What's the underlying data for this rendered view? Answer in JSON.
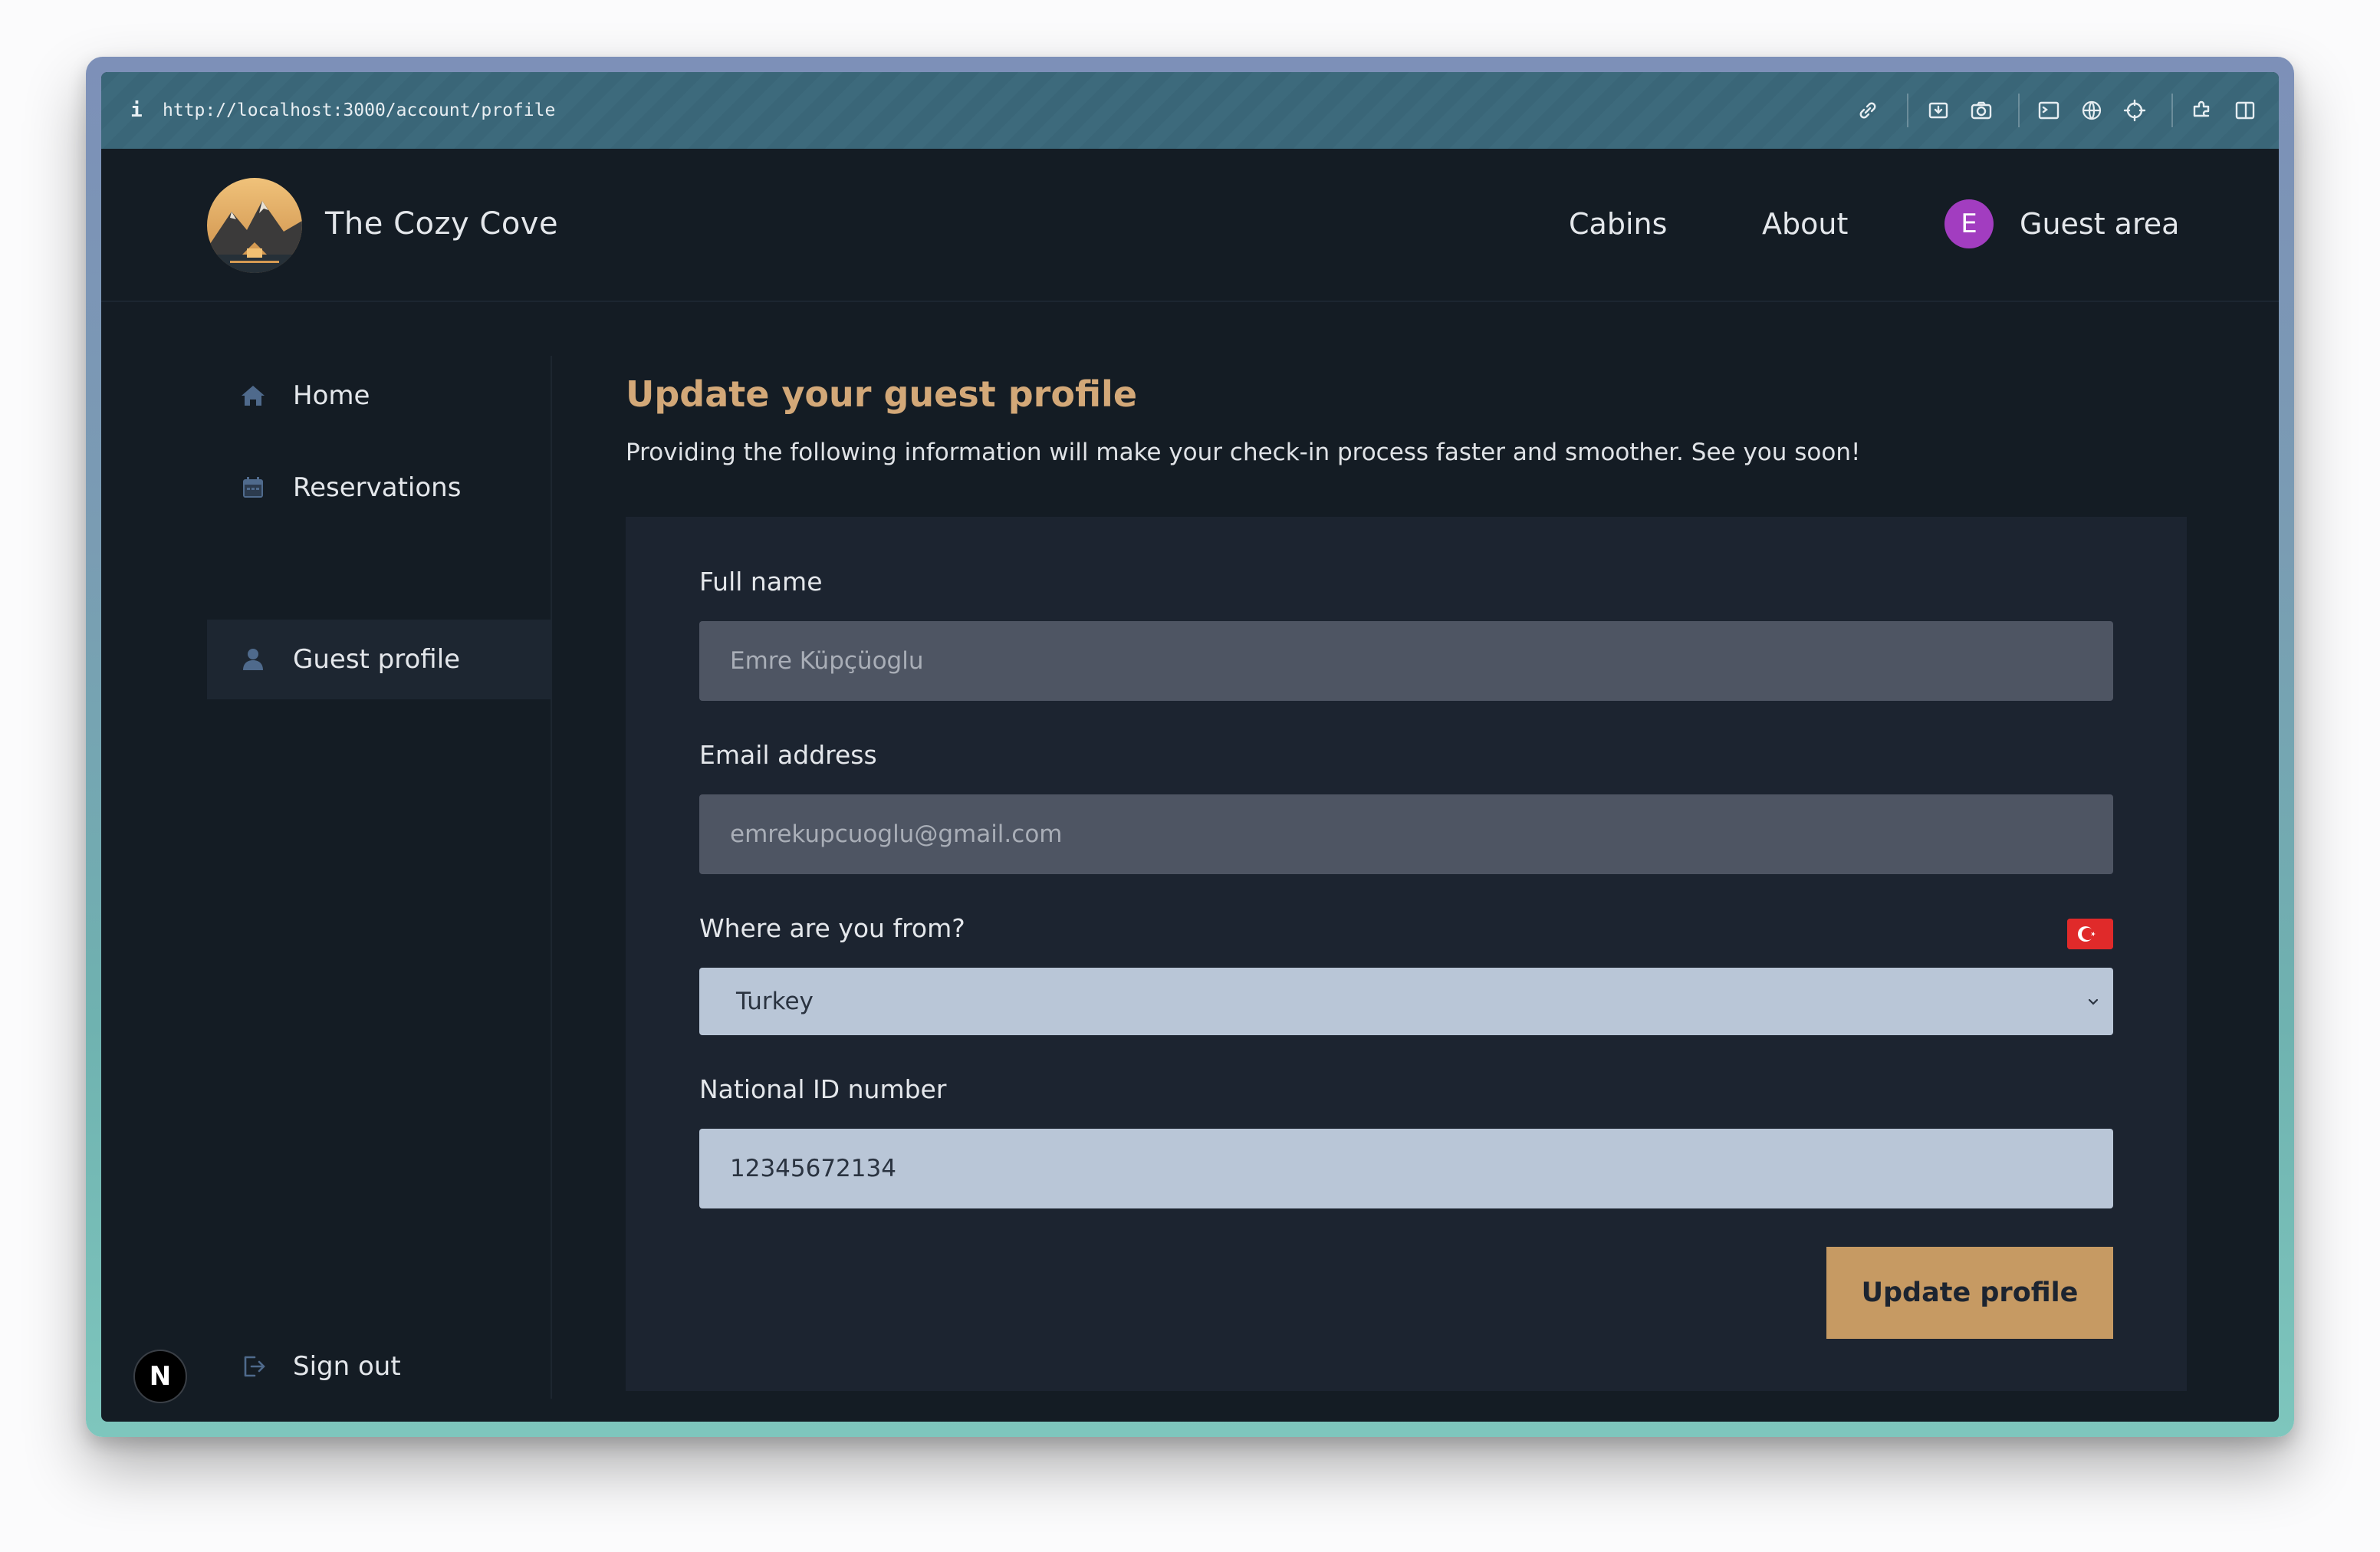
{
  "browser": {
    "url": "http://localhost:3000/account/profile",
    "info_icon": "i"
  },
  "header": {
    "brand": "The Cozy Cove",
    "nav": [
      {
        "label": "Cabins"
      },
      {
        "label": "About"
      }
    ],
    "guest_area": {
      "avatar_initial": "E",
      "label": "Guest area"
    }
  },
  "sidebar": {
    "items": [
      {
        "label": "Home",
        "icon": "home-icon"
      },
      {
        "label": "Reservations",
        "icon": "calendar-icon"
      },
      {
        "label": "Guest profile",
        "icon": "user-icon",
        "active": true
      }
    ],
    "sign_out": {
      "label": "Sign out",
      "icon": "sign-out-icon"
    }
  },
  "main": {
    "title": "Update your guest profile",
    "description": "Providing the following information will make your check-in process faster and smoother. See you soon!",
    "form": {
      "full_name": {
        "label": "Full name",
        "value": "Emre Küpçüoglu",
        "disabled": true
      },
      "email": {
        "label": "Email address",
        "value": "emrekupcuoglu@gmail.com",
        "disabled": true
      },
      "country": {
        "label": "Where are you from?",
        "selected": "Turkey",
        "flag": "turkey-flag-icon"
      },
      "national_id": {
        "label": "National ID number",
        "value": "12345672134"
      },
      "submit_label": "Update profile"
    }
  },
  "dev_badge": "N",
  "colors": {
    "accent": "#c69a63",
    "title": "#d3a878",
    "background": "#141c24",
    "card": "#1c2430",
    "avatar": "#a23dc0"
  }
}
